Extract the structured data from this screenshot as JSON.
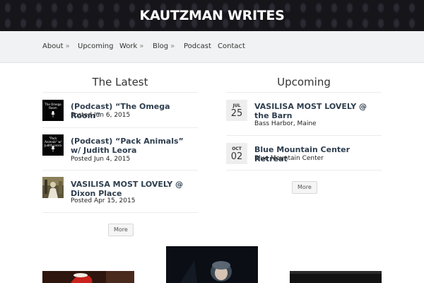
{
  "site": {
    "title": "KAUTZMAN WRITES"
  },
  "nav": {
    "items": [
      {
        "label": "About",
        "arrow": "»"
      },
      {
        "label": "Upcoming",
        "arrow": ""
      },
      {
        "label": "Work",
        "arrow": "»"
      },
      {
        "label": "Blog",
        "arrow": "»"
      },
      {
        "label": "Podcast",
        "arrow": ""
      },
      {
        "label": "Contact",
        "arrow": ""
      }
    ]
  },
  "latest": {
    "heading": "The Latest",
    "posts": [
      {
        "title": "(Podcast) “The Omega Room”",
        "meta": "Posted Jun 6, 2015",
        "thumb_text": "The Omega Room",
        "thumb_icon": "microphone-icon"
      },
      {
        "title": "(Podcast) “Pack Animals” w/ Judith Leora",
        "meta": "Posted Jun 4, 2015",
        "thumb_text": "\"Pack Animals\" w/ Judith Leora",
        "thumb_icon": "microphone-icon"
      },
      {
        "title": "VASILISA MOST LOVELY @ Dixon Place",
        "meta": "Posted Apr 15, 2015",
        "thumb_text": "",
        "thumb_icon": "photo-thumbnail"
      }
    ],
    "more_label": "More"
  },
  "upcoming": {
    "heading": "Upcoming",
    "events": [
      {
        "month": "JUL",
        "day": "25",
        "title": "VASILISA MOST LOVELY @ the Barn",
        "location": "Bass Harbor, Maine"
      },
      {
        "month": "OCT",
        "day": "02",
        "title": "Blue Mountain Center Retreat",
        "location": "Blue Mountain Center"
      }
    ],
    "more_label": "More"
  },
  "colors": {
    "header_bg": "#15151a",
    "nav_bg": "#f1f2f3",
    "link_title": "#2e3e4e",
    "date_box_bg": "#eeeeee"
  }
}
